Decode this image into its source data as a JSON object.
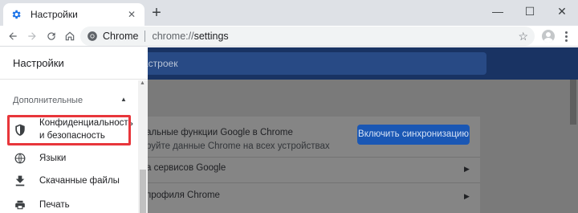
{
  "browser": {
    "tab_title": "Настройки",
    "new_tab_label": "+",
    "window_controls": {
      "minimize": "—",
      "maximize": "☐",
      "close": "✕"
    },
    "tab_close": "✕"
  },
  "omnibox": {
    "site_name": "Chrome",
    "scheme": "chrome://",
    "path": "settings"
  },
  "page": {
    "search_placeholder": "астроек",
    "sync_card": {
      "title": "альные функции Google в Chrome",
      "subtitle": "руйте данные Chrome на всех устройствах",
      "button": "Включить синхронизацию"
    },
    "links": [
      {
        "label": "а сервисов Google"
      },
      {
        "label": "профиля Chrome"
      }
    ]
  },
  "drawer": {
    "title": "Настройки",
    "section": "Дополнительные",
    "items": [
      {
        "label": "Конфиденциальность и безопасность",
        "icon": "shield-icon"
      },
      {
        "label": "Языки",
        "icon": "globe-icon"
      },
      {
        "label": "Скачанные файлы",
        "icon": "download-icon"
      },
      {
        "label": "Печать",
        "icon": "print-icon"
      }
    ]
  },
  "colors": {
    "accent": "#1a73e8",
    "highlight": "#e8363b",
    "header": "#193363"
  }
}
